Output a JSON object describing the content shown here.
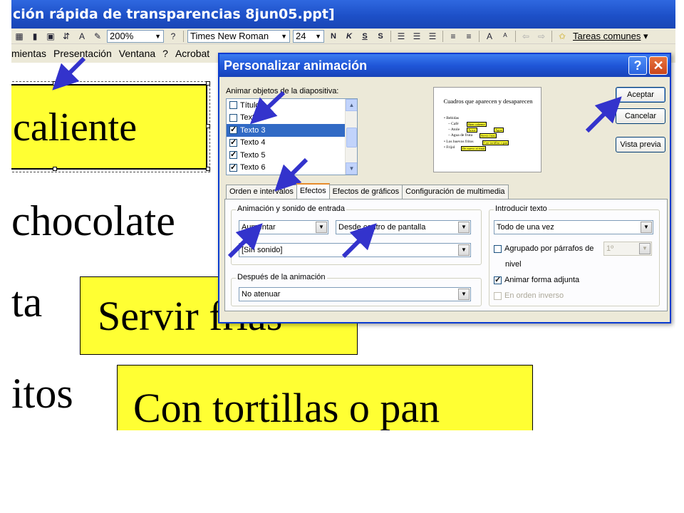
{
  "window": {
    "title": "ción rápida de transparencias 8jun05.ppt]"
  },
  "toolbar": {
    "zoom": "200%",
    "font": "Times New Roman",
    "size": "24",
    "bold": "N",
    "italic": "K",
    "underline": "S",
    "shadow": "S",
    "tasks_label": "Tareas comunes"
  },
  "menu": {
    "items": [
      "mientas",
      "Presentación",
      "Ventana",
      "?",
      "Acrobat"
    ]
  },
  "slide": {
    "texts": {
      "caliente": "caliente",
      "chocolate": "chocolate",
      "ta": "ta",
      "itos": "itos",
      "servir": "Servir frías",
      "tortillas": "Con tortillas o pan"
    },
    "box_color": "#ffff33"
  },
  "dialog": {
    "title": "Personalizar animación",
    "help": "?",
    "close": "✕",
    "objects_label": "Animar objetos de la diapositiva:",
    "objects": [
      {
        "label": "Título",
        "checked": false,
        "selected": false
      },
      {
        "label": "Texto 2",
        "checked": false,
        "selected": false
      },
      {
        "label": "Texto 3",
        "checked": true,
        "selected": true
      },
      {
        "label": "Texto 4",
        "checked": true,
        "selected": false
      },
      {
        "label": "Texto 5",
        "checked": true,
        "selected": false
      },
      {
        "label": "Texto 6",
        "checked": true,
        "selected": false
      }
    ],
    "preview": {
      "title": "Cuadros que aparecen y desaparecen",
      "lines": [
        "• Bebidas",
        "– Café",
        "– Atole",
        "– Agua de fruta",
        "• Los huevos fritos",
        "• Frijol"
      ],
      "tags": [
        "Bien caliente",
        "Arroz",
        "Agua",
        "Con tortillas o pan",
        "Servir frías",
        "De nuevo al final"
      ]
    },
    "buttons": {
      "accept": "Aceptar",
      "cancel": "Cancelar",
      "preview": "Vista previa"
    },
    "tabs": [
      "Orden e intervalos",
      "Efectos",
      "Efectos de gráficos",
      "Configuración de multimedia"
    ],
    "active_tab": "Efectos",
    "entry_group": {
      "title": "Animación y sonido de entrada",
      "effect": "Aumentar",
      "direction": "Desde centro de pantalla",
      "sound": "[Sin sonido]"
    },
    "after_group": {
      "title": "Después de la animación",
      "value": "No atenuar"
    },
    "text_group": {
      "title": "Introducir texto",
      "value": "Todo de una vez",
      "grouped_label": "Agrupado por párrafos de",
      "grouped_level": "1º",
      "level_label": "nivel",
      "animate_shape": "Animar forma adjunta",
      "reverse_order": "En orden inverso"
    }
  },
  "annotation_arrows": {
    "color": "#3333cc",
    "count": 6
  }
}
